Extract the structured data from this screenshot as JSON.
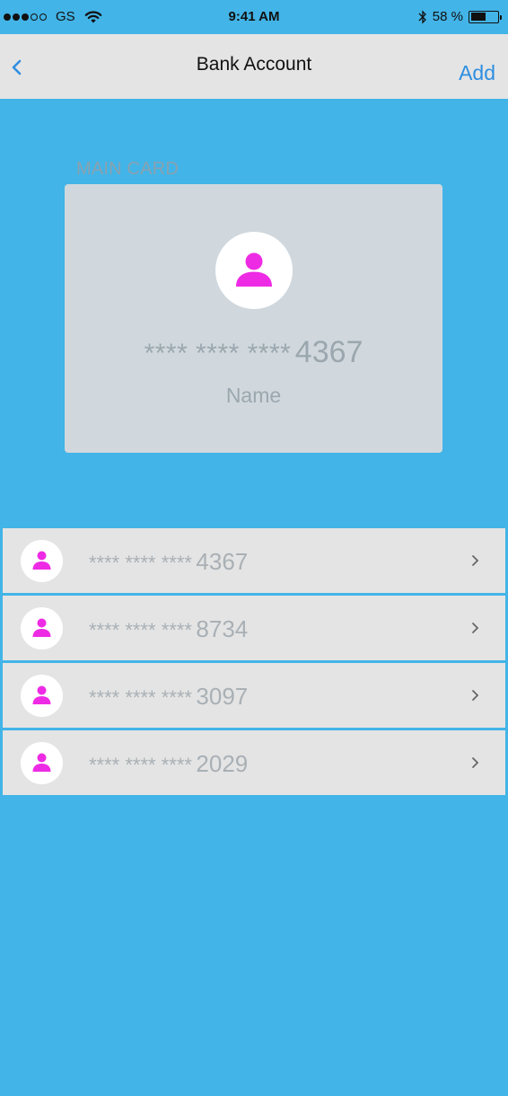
{
  "status_bar": {
    "carrier": "GS",
    "time": "9:41 AM",
    "battery_text": "58 %",
    "battery_level": 0.58,
    "signal_bars_filled": 3,
    "signal_bars_total": 5,
    "icons": [
      "wifi-icon",
      "bluetooth-icon",
      "battery-icon"
    ]
  },
  "nav": {
    "title": "Bank Account",
    "back_icon": "chevron-left-icon",
    "add_label": "Add"
  },
  "main_card": {
    "label": "MAIN CARD",
    "masked": "**** **** ****",
    "last4": "4367",
    "name": "Name",
    "avatar_icon": "user-icon"
  },
  "cards": [
    {
      "masked": "**** **** ****",
      "last4": "4367"
    },
    {
      "masked": "**** **** ****",
      "last4": "8734"
    },
    {
      "masked": "**** **** ****",
      "last4": "3097"
    },
    {
      "masked": "**** **** ****",
      "last4": "2029"
    }
  ],
  "colors": {
    "background": "#42b4e7",
    "accent_icon": "#ee2be4",
    "link": "#2e8ee0",
    "card_bg": "#d0d8de",
    "row_bg": "#e4e4e4"
  }
}
